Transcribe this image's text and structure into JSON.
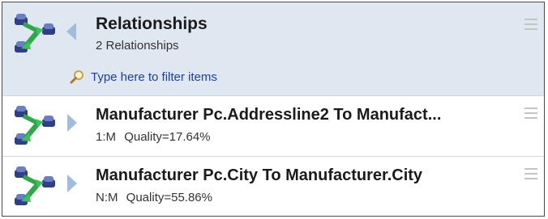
{
  "header": {
    "title": "Relationships",
    "count_text": "2 Relationships",
    "filter_placeholder": "Type here to filter items",
    "icon": "relationship-connector-icon"
  },
  "items": [
    {
      "title": "Manufacturer Pc.Addressline2 To Manufact...",
      "cardinality": "1:M",
      "quality": "Quality=17.64%",
      "icon": "relationship-connector-icon"
    },
    {
      "title": "Manufacturer Pc.City To Manufacturer.City",
      "cardinality": "N:M",
      "quality": "Quality=55.86%",
      "icon": "relationship-connector-icon"
    }
  ],
  "colors": {
    "header_bg": "#dfe7f1",
    "link": "#1a3fb0",
    "caret": "#9fbde0",
    "icon_navy": "#2f3f86",
    "icon_green": "#2fa84a"
  }
}
